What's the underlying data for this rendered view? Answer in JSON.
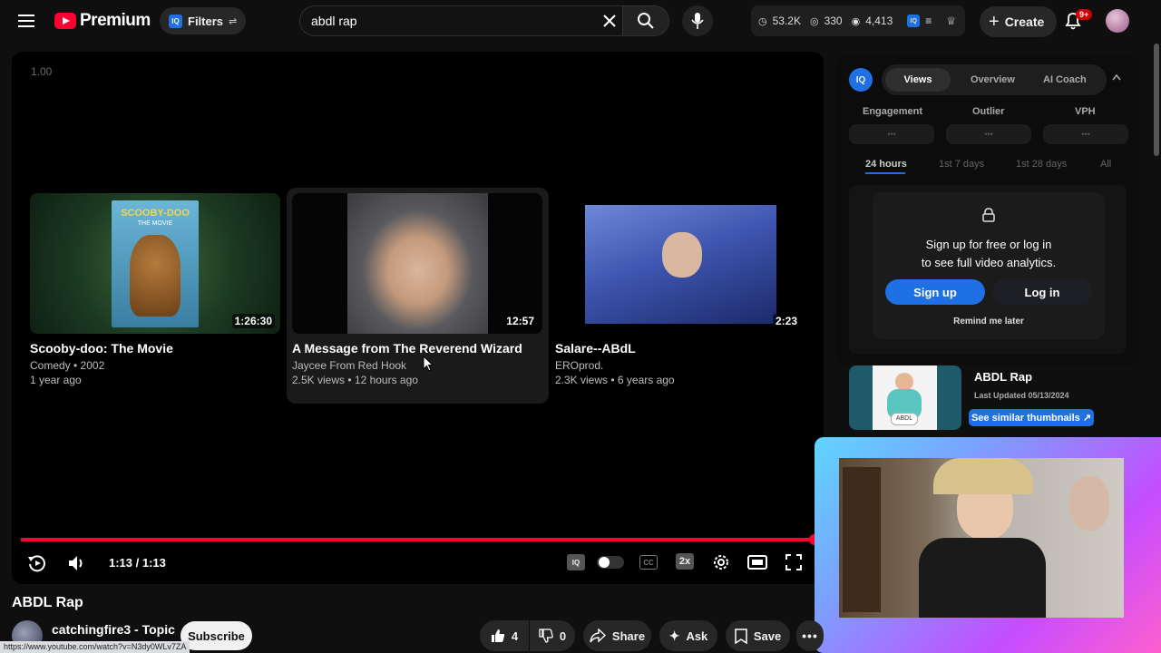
{
  "header": {
    "brand": "Premium",
    "filters_label": "Filters",
    "search_value": "abdl rap",
    "stats": {
      "views": "53.2K",
      "eyes": "330",
      "watching": "4,413"
    },
    "create_label": "Create",
    "notifications_badge": "9+"
  },
  "player": {
    "speed_readout": "1.00",
    "progress": 1.0,
    "time": "1:13 / 1:13",
    "speed_button": "2x",
    "end_cards": [
      {
        "title": "Scooby-doo: The Movie",
        "meta1": "Comedy • 2002",
        "meta2": "1 year ago",
        "duration": "1:26:30",
        "poster_text": "SCOOBY-DOO",
        "poster_sub": "THE MOVIE"
      },
      {
        "title": "A Message from The Reverend Wizard",
        "meta1": "Jaycee From Red Hook",
        "meta2": "2.5K views • 12 hours ago",
        "duration": "12:57"
      },
      {
        "title": "Salare--ABdL",
        "meta1": "EROprod.",
        "meta2": "2.3K views • 6 years ago",
        "duration": "2:23"
      }
    ]
  },
  "panel": {
    "tabs": [
      "Views",
      "Overview",
      "AI Coach"
    ],
    "metrics": [
      "Engagement",
      "Outlier",
      "VPH"
    ],
    "metric_values": [
      "•••",
      "•••",
      "•••"
    ],
    "ranges": [
      "24 hours",
      "1st 7 days",
      "1st 28 days",
      "All"
    ],
    "overlay_line1": "Sign up for free or log in",
    "overlay_line2": "to see full video analytics.",
    "signup_label": "Sign up",
    "login_label": "Log in",
    "remind_label": "Remind me later",
    "suggest_title": "ABDL Rap",
    "suggest_updated": "Last Updated 05/13/2024",
    "suggest_button": "See similar thumbnails ↗",
    "suggest_thumb_text": "ABDL"
  },
  "video": {
    "title": "ABDL Rap",
    "channel": "catchingfire3 - Topic",
    "subscribe_label": "Subscribe",
    "like_count": "4",
    "dislike_count": "0",
    "share_label": "Share",
    "ask_label": "Ask",
    "save_label": "Save"
  },
  "status_url": "https://www.youtube.com/watch?v=N3dy0WLv7ZA",
  "colors": {
    "accent_red": "#ff0033",
    "iq_blue": "#1f6fe5",
    "webcam_frame": "#c44dff"
  }
}
